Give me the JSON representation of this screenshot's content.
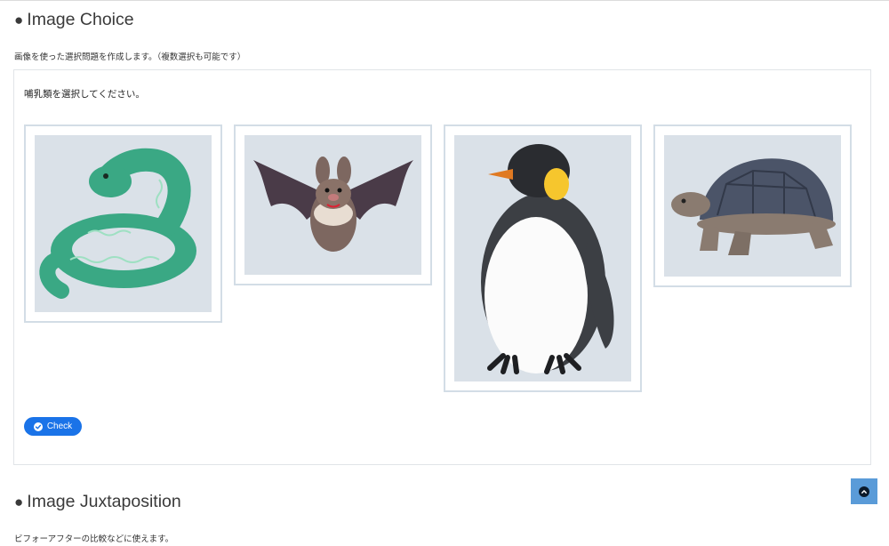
{
  "sections": [
    {
      "bullet": "●",
      "title": "Image Choice",
      "description": "画像を使った選択問題を作成します。（複数選択も可能です）"
    },
    {
      "bullet": "●",
      "title": "Image Juxtaposition",
      "description": "ビフォーアフターの比較などに使えます。"
    }
  ],
  "quiz": {
    "question": "哺乳類を選択してください。",
    "choices": [
      {
        "icon": "snake-illustration",
        "selected": false
      },
      {
        "icon": "bat-illustration",
        "selected": false
      },
      {
        "icon": "penguin-illustration",
        "selected": false
      },
      {
        "icon": "tortoise-illustration",
        "selected": false
      }
    ],
    "check_button": {
      "label": "Check",
      "icon": "check-circle-icon",
      "color": "#1a73e8"
    }
  },
  "scroll_top_button": {
    "icon": "chevron-up-circle-icon",
    "color": "#5a9bd8"
  },
  "colors": {
    "image_background": "#dae1e8",
    "choice_border": "#d3dde6"
  }
}
